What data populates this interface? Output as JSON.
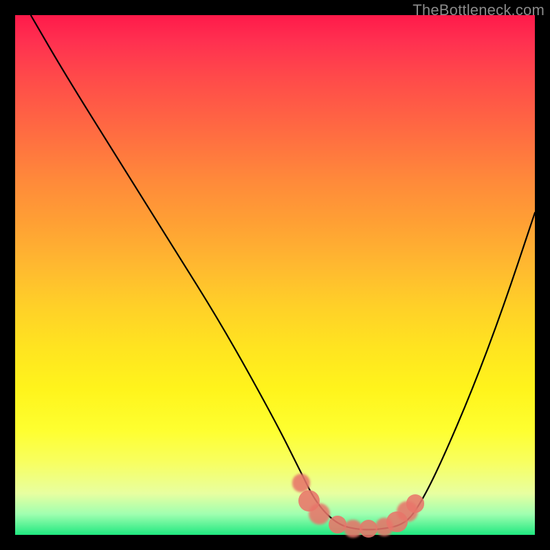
{
  "watermark": "TheBottleneck.com",
  "chart_data": {
    "type": "line",
    "title": "",
    "xlabel": "",
    "ylabel": "",
    "xlim": [
      0,
      100
    ],
    "ylim": [
      0,
      100
    ],
    "grid": false,
    "background_gradient": {
      "direction": "vertical",
      "stops": [
        {
          "pos": 0,
          "color": "#ff1a4a"
        },
        {
          "pos": 50,
          "color": "#ffc028"
        },
        {
          "pos": 85,
          "color": "#feff40"
        },
        {
          "pos": 100,
          "color": "#20e880"
        }
      ]
    },
    "series": [
      {
        "name": "bottleneck-curve",
        "stroke": "#000000",
        "x": [
          3,
          10,
          20,
          30,
          40,
          50,
          55,
          58,
          62,
          66,
          70,
          75,
          78,
          82,
          88,
          94,
          100
        ],
        "values": [
          100,
          88,
          72,
          56,
          40,
          22,
          12,
          6,
          2,
          1,
          1,
          2,
          6,
          14,
          28,
          44,
          62
        ]
      }
    ],
    "markers": {
      "name": "matching-range",
      "color": "#e8756a",
      "points": [
        {
          "x": 55.0,
          "y": 10.0,
          "r": 6
        },
        {
          "x": 56.5,
          "y": 6.5,
          "r": 7
        },
        {
          "x": 58.5,
          "y": 4.0,
          "r": 7
        },
        {
          "x": 62.0,
          "y": 2.0,
          "r": 6
        },
        {
          "x": 65.0,
          "y": 1.2,
          "r": 6
        },
        {
          "x": 68.0,
          "y": 1.2,
          "r": 6
        },
        {
          "x": 71.0,
          "y": 1.5,
          "r": 6
        },
        {
          "x": 73.5,
          "y": 2.5,
          "r": 7
        },
        {
          "x": 75.5,
          "y": 4.5,
          "r": 7
        },
        {
          "x": 77.0,
          "y": 6.0,
          "r": 6
        }
      ]
    }
  }
}
